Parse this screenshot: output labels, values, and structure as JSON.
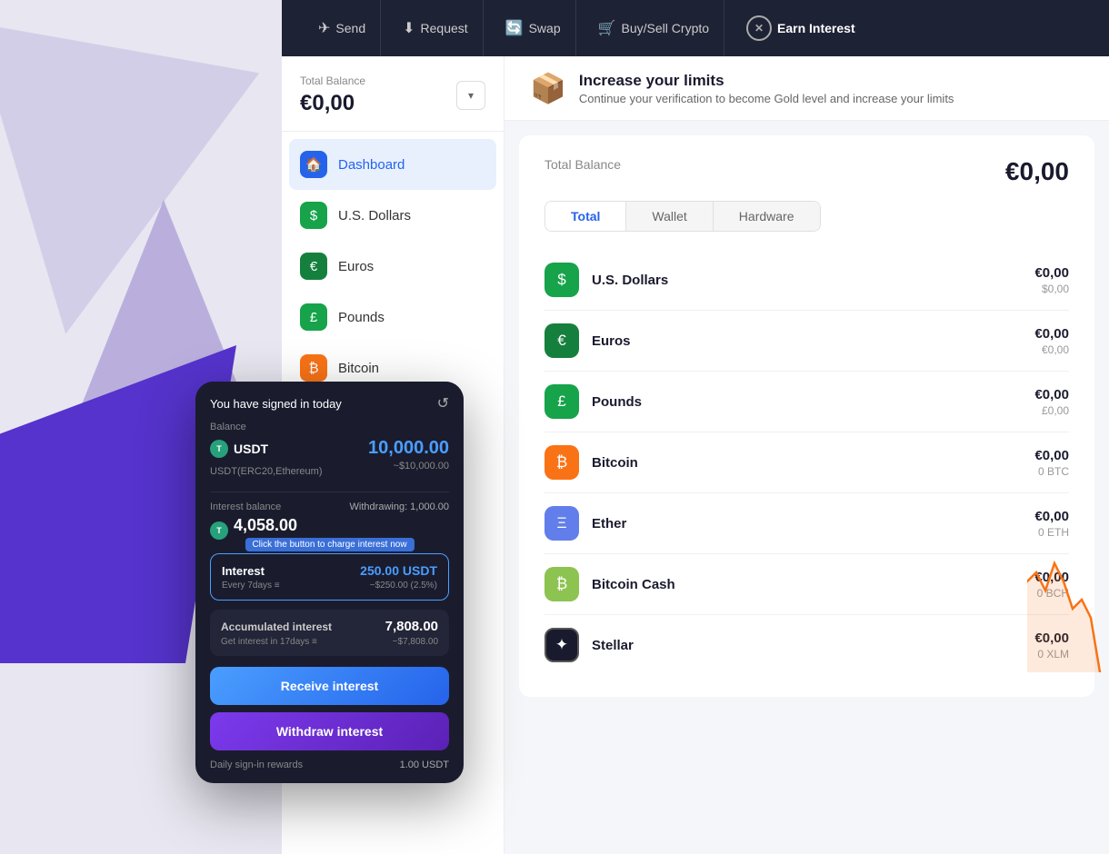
{
  "background": {
    "color": "#e8e6f0"
  },
  "topnav": {
    "items": [
      {
        "id": "send",
        "label": "Send",
        "icon": "✈"
      },
      {
        "id": "request",
        "label": "Request",
        "icon": "⬇"
      },
      {
        "id": "swap",
        "label": "Swap",
        "icon": "🔄"
      },
      {
        "id": "buysell",
        "label": "Buy/Sell Crypto",
        "icon": "🛒"
      },
      {
        "id": "earninterest",
        "label": "Earn Interest",
        "icon": "✕"
      }
    ]
  },
  "sidebar": {
    "balance_label": "Total Balance",
    "balance_amount": "€0,00",
    "items": [
      {
        "id": "dashboard",
        "label": "Dashboard",
        "icon": "🏠",
        "active": true,
        "icon_class": "icon-blue"
      },
      {
        "id": "usdollars",
        "label": "U.S. Dollars",
        "icon": "$",
        "active": false,
        "icon_class": "icon-green"
      },
      {
        "id": "euros",
        "label": "Euros",
        "icon": "€",
        "active": false,
        "icon_class": "icon-green2"
      },
      {
        "id": "pounds",
        "label": "Pounds",
        "icon": "£",
        "active": false,
        "icon_class": "icon-green3"
      },
      {
        "id": "bitcoin",
        "label": "Bitcoin",
        "icon": "₿",
        "active": false,
        "icon_class": "icon-orange"
      }
    ]
  },
  "limits_banner": {
    "icon": "📦",
    "title": "Increase your limits",
    "subtitle": "Continue your verification to become Gold level and increase your limits"
  },
  "portfolio": {
    "label": "Total Balance",
    "amount": "€0,00",
    "tabs": [
      {
        "id": "total",
        "label": "Total",
        "active": true
      },
      {
        "id": "wallet",
        "label": "Wallet",
        "active": false
      },
      {
        "id": "hardware",
        "label": "Hardware",
        "active": false
      }
    ],
    "currencies": [
      {
        "id": "usdollars",
        "name": "U.S. Dollars",
        "icon": "$",
        "icon_class": "icon-green",
        "eur": "€0,00",
        "sub": "$0,00"
      },
      {
        "id": "euros",
        "name": "Euros",
        "icon": "€",
        "icon_class": "icon-green2",
        "eur": "€0,00",
        "sub": "€0,00"
      },
      {
        "id": "pounds",
        "name": "Pounds",
        "icon": "£",
        "icon_class": "icon-green3",
        "eur": "€0,00",
        "sub": "£0,00"
      },
      {
        "id": "bitcoin",
        "name": "Bitcoin",
        "icon": "₿",
        "icon_class": "icon-orange",
        "eur": "€0,00",
        "sub": "0 BTC"
      },
      {
        "id": "ether",
        "name": "Ether",
        "icon": "Ξ",
        "icon_class": "icon-blue-eth",
        "eur": "€0,00",
        "sub": "0 ETH"
      },
      {
        "id": "bitcoincash",
        "name": "Bitcoin Cash",
        "icon": "₿",
        "icon_class": "icon-green-bch",
        "eur": "€0,00",
        "sub": "0 BCH"
      },
      {
        "id": "stellar",
        "name": "Stellar",
        "icon": "✦",
        "icon_class": "icon-stellar",
        "eur": "€0,00",
        "sub": "0 XLM"
      }
    ]
  },
  "mobile_card": {
    "signed_in_text": "You have signed in today",
    "balance_label": "Balance",
    "usdt_label": "USDT",
    "usdt_amount": "10,000.00",
    "usdt_sub": "~$10,000.00",
    "usdt_network": "USDT(ERC20,Ethereum)",
    "interest_balance_label": "Interest balance",
    "withdrawing_label": "Withdrawing: 1,000.00",
    "interest_balance_amount": "4,058.00",
    "tooltip_text": "Click the button to charge interest now",
    "interest_label": "Interest",
    "interest_amount": "250.00 USDT",
    "interest_freq": "Every 7days ≡",
    "interest_approx": "~$250.00 (2.5%)",
    "accumulated_label": "Accumulated interest",
    "accumulated_amount": "7,808.00",
    "accumulated_days": "Get interest in 17days ≡",
    "accumulated_approx": "~$7,808.00",
    "receive_btn": "Receive interest",
    "withdraw_btn": "Withdraw interest",
    "daily_label": "Daily sign-in rewards",
    "daily_amount": "1.00 USDT"
  }
}
